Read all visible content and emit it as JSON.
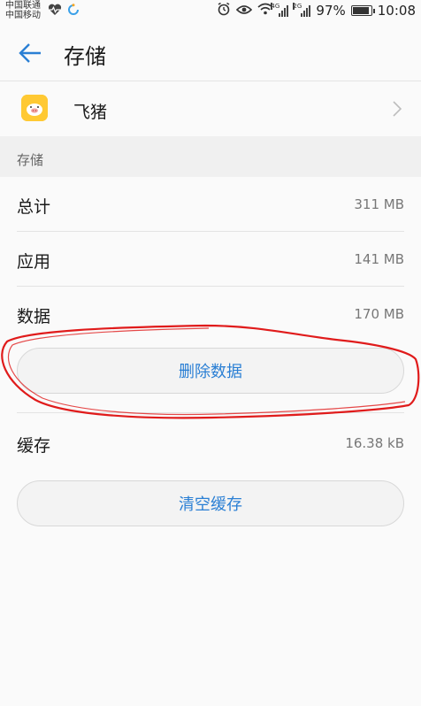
{
  "status_bar": {
    "carrier_1": "中国联通",
    "carrier_2": "中国移动",
    "network_tag_1": "4G",
    "network_tag_2": "2G",
    "battery": "97%",
    "time": "10:08"
  },
  "header": {
    "title": "存储"
  },
  "app": {
    "name": "飞猪"
  },
  "section": {
    "title": "存储"
  },
  "storage_rows": [
    {
      "label": "总计",
      "value": "311 MB"
    },
    {
      "label": "应用",
      "value": "141 MB"
    },
    {
      "label": "数据",
      "value": "170 MB"
    }
  ],
  "delete_data_button": "删除数据",
  "cache_row": {
    "label": "缓存",
    "value": "16.38 kB"
  },
  "clear_cache_button": "清空缓存",
  "colors": {
    "accent": "#2a7fd4",
    "annotation": "#e01b1b",
    "app_icon": "#ffc933"
  }
}
